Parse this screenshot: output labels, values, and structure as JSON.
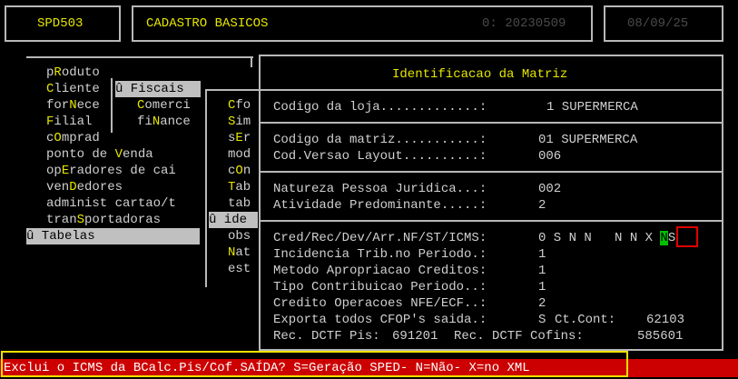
{
  "header": {
    "program": "SPD503",
    "title": "CADASTRO BASICOS",
    "code": "0: 20230509",
    "date": "08/09/25"
  },
  "menu_main": [
    {
      "label": "pRoduto"
    },
    {
      "label": "Cliente"
    },
    {
      "label": "forNece"
    },
    {
      "label": "Filial"
    },
    {
      "label": "cOmprad"
    },
    {
      "label": "ponto de Venda"
    },
    {
      "label": "opEradores de cai"
    },
    {
      "label": "venDedores"
    },
    {
      "label": "administ cartao/t"
    },
    {
      "label": "tranSportadoras"
    },
    {
      "label": "û Tabelas"
    }
  ],
  "menu_fiscais": {
    "title": "û Fiscais",
    "items": [
      "Comerci",
      "fiNance"
    ]
  },
  "menu_tabelas": [
    "Cfo",
    "Sim",
    "sEr",
    "mod",
    "cOn",
    "Tab",
    "tab",
    "û ide",
    "obs",
    "Nat",
    "est"
  ],
  "dialog": {
    "title": "Identificacao da Matriz",
    "fields": {
      "loja_label": "Codigo da loja.............:",
      "loja_value": "1 SUPERMERCA",
      "matriz_label": "Codigo da matriz...........:",
      "matriz_value": "01 SUPERMERCA",
      "versao_label": "Cod.Versao Layout..........:",
      "versao_value": "006",
      "natureza_label": "Natureza Pessoa Juridica...:",
      "natureza_value": "002",
      "atividade_label": "Atividade Predominante.....:",
      "atividade_value": "2",
      "cred_label": "Cred/Rec/Dev/Arr.NF/ST/ICMS:",
      "cred_value_a": "0 S N N   N N X ",
      "cred_value_sel": "N",
      "cred_value_b": "S",
      "incid_label": "Incidencia Trib.no Periodo.:",
      "incid_value": "1",
      "metodo_label": "Metodo Apropriacao Creditos:",
      "metodo_value": "1",
      "tipo_label": "Tipo Contribuicao Periodo..:",
      "tipo_value": "1",
      "credop_label": "Credito Operacoes NFE/ECF..:",
      "credop_value": "2",
      "exporta_label": "Exporta todos CFOP's saida.:",
      "exporta_value": "S",
      "ctcont_label": "Ct.Cont:",
      "ctcont_value": "62103",
      "recpis_label": "Rec. DCTF Pis:",
      "recpis_value": "691201",
      "reccof_label": "Rec. DCTF Cofins:",
      "reccof_value": "585601"
    }
  },
  "status": {
    "message": "Exclui o ICMS da BCalc.Pis/Cof.SAÍDA? S=Geração SPED- N=Não- X=no XML"
  },
  "colors": {
    "hotkey": "#e6e600",
    "status_bg": "#cc0000",
    "selection": "#00c000"
  }
}
